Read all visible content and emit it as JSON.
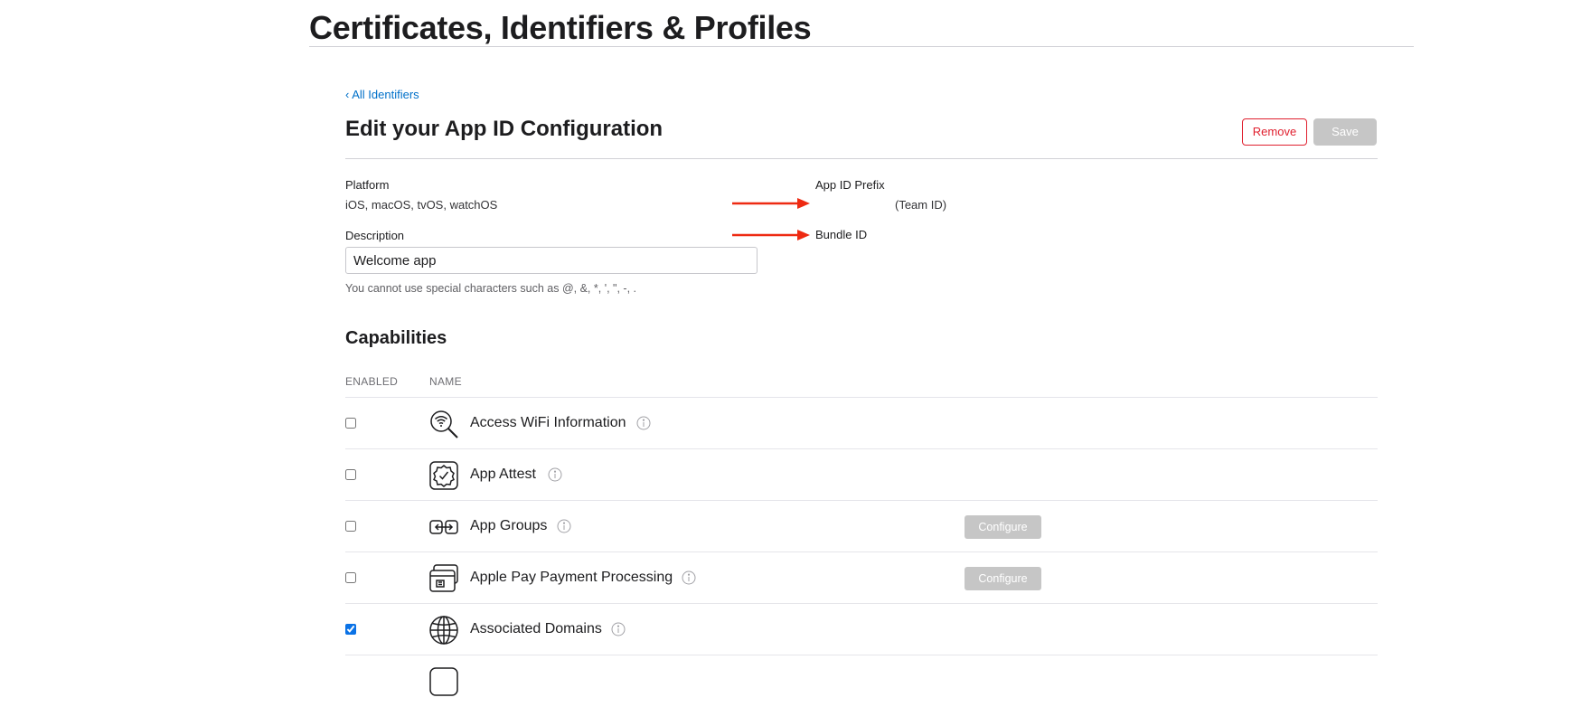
{
  "header": {
    "title": "Certificates, Identifiers & Profiles"
  },
  "nav": {
    "back_link": "‹ All Identifiers"
  },
  "section": {
    "title": "Edit your App ID Configuration"
  },
  "actions": {
    "remove_label": "Remove",
    "save_label": "Save"
  },
  "fields": {
    "platform_label": "Platform",
    "platform_value": "iOS, macOS, tvOS, watchOS",
    "prefix_label": "App ID Prefix",
    "prefix_value": "(Team ID)",
    "bundle_label": "Bundle ID",
    "description_label": "Description",
    "description_value": "Welcome app",
    "description_hint": "You cannot use special characters such as @, &, *, ', \", -, ."
  },
  "annotation": {
    "arrow_color": "#ee2a12"
  },
  "capabilities": {
    "title": "Capabilities",
    "col_enabled": "ENABLED",
    "col_name": "NAME",
    "configure_label": "Configure",
    "items": [
      {
        "name": "Access WiFi Information",
        "enabled": false,
        "icon": "wifi-search-icon",
        "configurable": false
      },
      {
        "name": "App Attest",
        "enabled": false,
        "icon": "badge-check-icon",
        "configurable": false
      },
      {
        "name": "App Groups",
        "enabled": false,
        "icon": "app-groups-icon",
        "configurable": true
      },
      {
        "name": "Apple Pay Payment Processing",
        "enabled": false,
        "icon": "credit-card-icon",
        "configurable": true
      },
      {
        "name": "Associated Domains",
        "enabled": true,
        "icon": "globe-icon",
        "configurable": false
      }
    ]
  },
  "colors": {
    "accent": "#0070c9",
    "danger": "#e0202f",
    "disabled": "#c6c6c6",
    "checkbox": "#0a72e6"
  }
}
